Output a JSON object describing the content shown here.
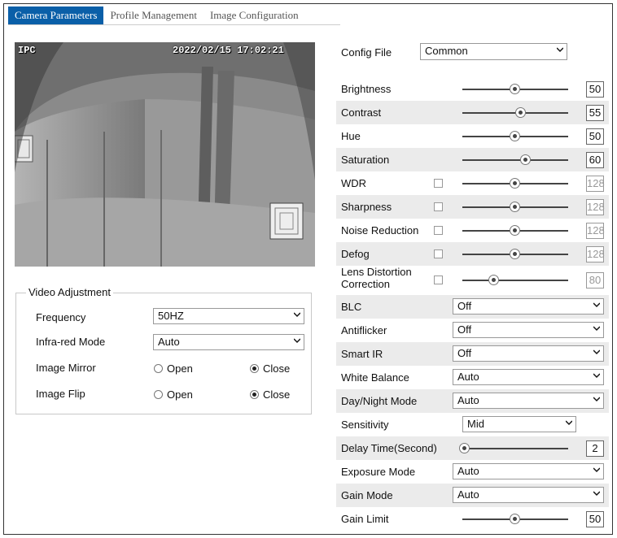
{
  "tabs": [
    {
      "label": "Camera Parameters",
      "active": true
    },
    {
      "label": "Profile Management",
      "active": false
    },
    {
      "label": "Image Configuration",
      "active": false
    }
  ],
  "preview": {
    "osd_name": "IPC",
    "osd_datetime": "2022/02/15 17:02:21"
  },
  "config_file": {
    "label": "Config File",
    "value": "Common"
  },
  "sliders": [
    {
      "label": "Brightness",
      "value": "50",
      "level": 0.5,
      "checkbox": false,
      "disabled": false
    },
    {
      "label": "Contrast",
      "value": "55",
      "level": 0.55,
      "checkbox": false,
      "disabled": false
    },
    {
      "label": "Hue",
      "value": "50",
      "level": 0.5,
      "checkbox": false,
      "disabled": false
    },
    {
      "label": "Saturation",
      "value": "60",
      "level": 0.6,
      "checkbox": false,
      "disabled": false
    },
    {
      "label": "WDR",
      "value": "128",
      "level": 0.5,
      "checkbox": true,
      "disabled": true
    },
    {
      "label": "Sharpness",
      "value": "128",
      "level": 0.5,
      "checkbox": true,
      "disabled": true
    },
    {
      "label": "Noise Reduction",
      "value": "128",
      "level": 0.5,
      "checkbox": true,
      "disabled": true
    },
    {
      "label": "Defog",
      "value": "128",
      "level": 0.5,
      "checkbox": true,
      "disabled": true
    },
    {
      "label": "Lens Distortion Correction",
      "value": "80",
      "level": 0.3,
      "checkbox": true,
      "disabled": true
    }
  ],
  "dropdowns": [
    {
      "label": "BLC",
      "value": "Off"
    },
    {
      "label": "Antiflicker",
      "value": "Off"
    },
    {
      "label": "Smart IR",
      "value": "Off"
    },
    {
      "label": "White Balance",
      "value": "Auto"
    },
    {
      "label": "Day/Night Mode",
      "value": "Auto"
    }
  ],
  "sensitivity": {
    "label": "Sensitivity",
    "value": "Mid"
  },
  "delay_time": {
    "label": "Delay Time(Second)",
    "value": "2",
    "level": 0.02
  },
  "dropdowns2": [
    {
      "label": "Exposure Mode",
      "value": "Auto"
    },
    {
      "label": "Gain Mode",
      "value": "Auto"
    }
  ],
  "gain_limit": {
    "label": "Gain Limit",
    "value": "50",
    "level": 0.5
  },
  "video_adjustment": {
    "title": "Video Adjustment",
    "frequency": {
      "label": "Frequency",
      "value": "50HZ"
    },
    "infrared": {
      "label": "Infra-red Mode",
      "value": "Auto"
    },
    "mirror": {
      "label": "Image Mirror",
      "open": "Open",
      "close": "Close",
      "selected": "Close"
    },
    "flip": {
      "label": "Image Flip",
      "open": "Open",
      "close": "Close",
      "selected": "Close"
    }
  }
}
